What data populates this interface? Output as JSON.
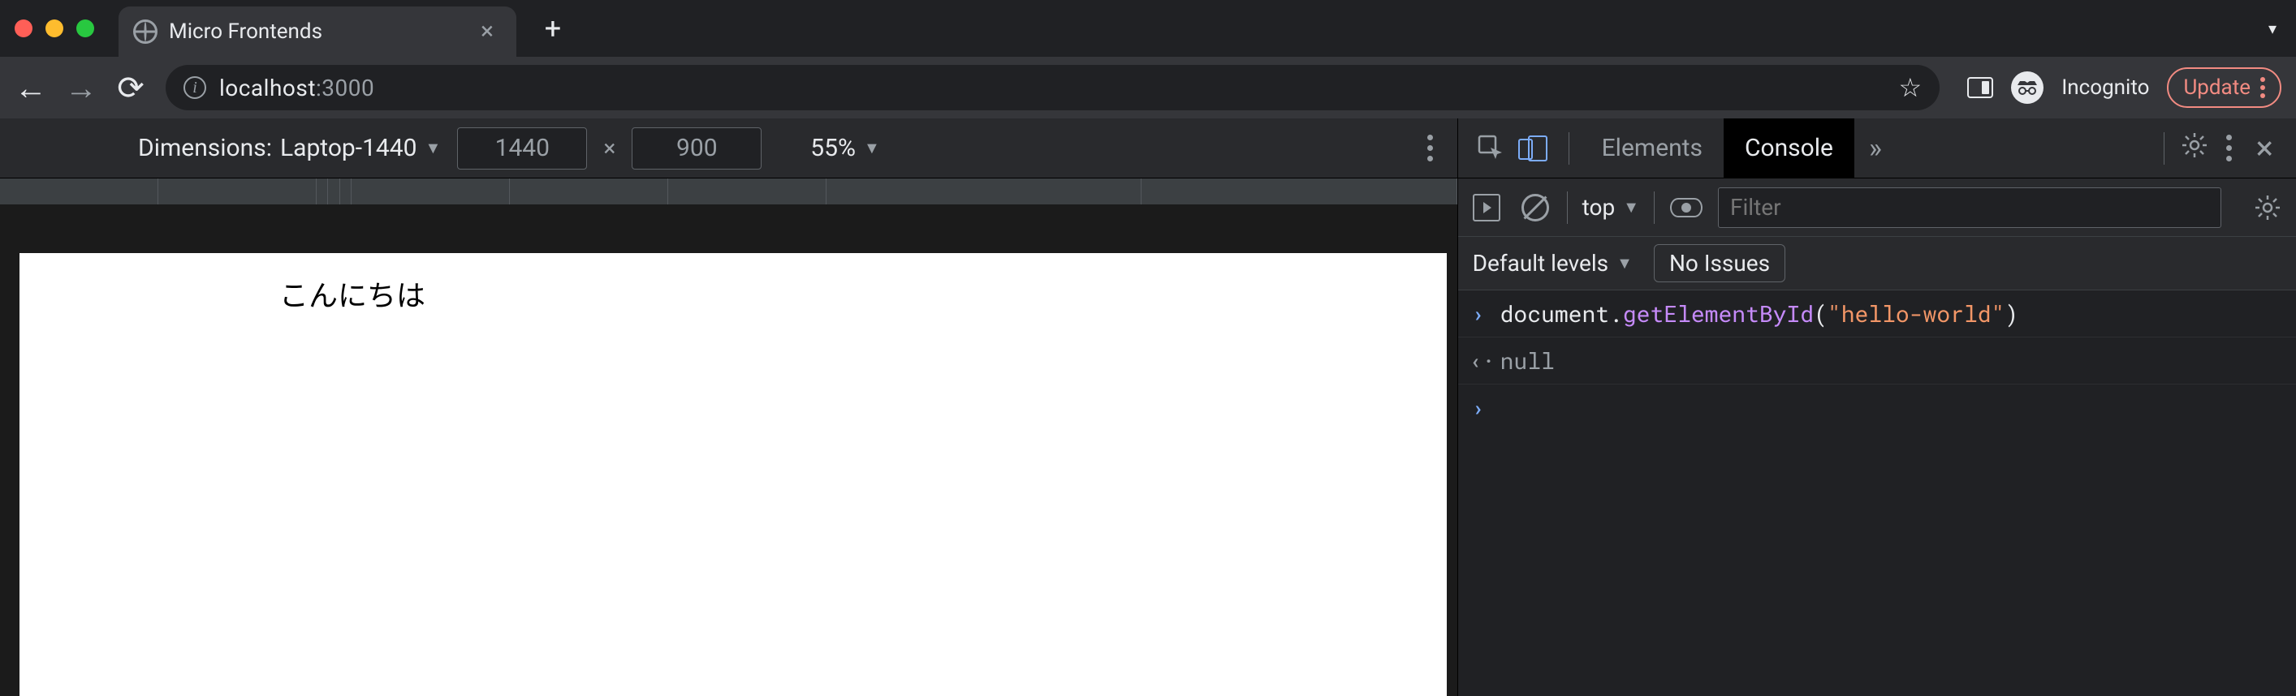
{
  "browser": {
    "tab_title": "Micro Frontends",
    "url_host": "localhost",
    "url_port": ":3000",
    "incognito_label": "Incognito",
    "update_label": "Update"
  },
  "device_bar": {
    "dimensions_prefix": "Dimensions: ",
    "dimensions_preset": "Laptop-1440",
    "width": "1440",
    "height": "900",
    "zoom": "55%"
  },
  "page": {
    "hello_text": "こんにちは"
  },
  "devtools": {
    "tabs": {
      "elements": "Elements",
      "console": "Console"
    },
    "more_glyph": "»",
    "console_toolbar": {
      "context": "top",
      "filter_placeholder": "Filter"
    },
    "console_subbar": {
      "levels_label": "Default levels",
      "issues_label": "No Issues"
    },
    "console_lines": {
      "input_obj": "document",
      "input_fn": "getElementById",
      "input_arg": "\"hello-world\"",
      "output": "null"
    }
  }
}
